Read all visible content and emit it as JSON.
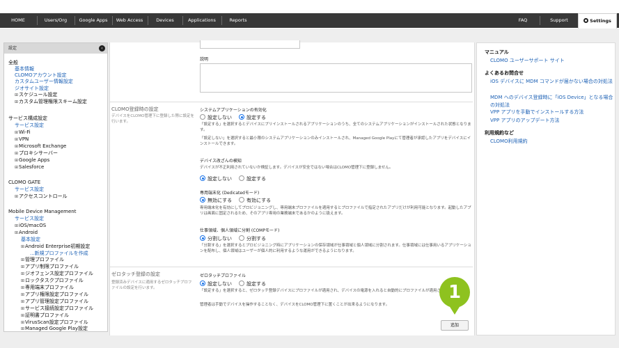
{
  "nav": {
    "items": [
      "HOME",
      "Users/Org",
      "Google Apps",
      "Web Access",
      "Devices",
      "Applications",
      "Reports"
    ],
    "right_items": [
      "FAQ",
      "Support"
    ],
    "settings_label": "Settings"
  },
  "sidebar": {
    "header": "設定",
    "collapse_icon": "‹",
    "groups": [
      {
        "title": "全般",
        "items": [
          "基本情報",
          "CLOMOアカウント設定",
          "カスタムユーザー情報設定",
          "ジオサイト設定",
          "スケジュール設定",
          "カスタム管理権限スキーム設定"
        ]
      },
      {
        "title": "サービス構成設定",
        "items": [
          "サービス設定",
          "Wi-Fi",
          "VPN",
          "Microsoft Exchange",
          "プロキシサーバー",
          "Google Apps",
          "Salesforce"
        ]
      },
      {
        "title": "CLOMO GATE",
        "items": [
          "サービス設定",
          "アクセスコントロール"
        ]
      },
      {
        "title": "Mobile Device Management",
        "items": [
          "サービス設定",
          "iOS/macOS",
          "Android",
          "基本設定",
          "Android Enterprise初期設定",
          "...新規プロファイルを作成",
          "管理プロファイル",
          "アプリ制限プロファイル",
          "ジオフェンス設定プロファイル",
          "ロックタスクプロファイル",
          "専用端末プロファイル",
          "アプリ権限設定プロファイル",
          "アプリ管理設定プロファイル",
          "サービス接続設定プロファイル",
          "証明書プロファイル",
          "VirusScan設定プロファイル",
          "Managed Google Play設定"
        ]
      }
    ]
  },
  "main": {
    "description_label": "説明",
    "section1": {
      "title": "CLOMO登録時の設定",
      "desc": "デバイスをCLOMO管理下に登録した際に設定を行います。",
      "system_apps": {
        "label": "システムアプリケーションの有効化",
        "options": [
          "設定しない",
          "設定する"
        ],
        "help1": "「設定する」を選択するとデバイスにプリインストールされるアプリケーションのうち、全てのシステムアプリケーションがインストールされた状態となります。",
        "help2": "「設定しない」を選択すると最小限のシステムアプリケーションのみインストールされ、Managed Google Playにて管理者が承認したアプリをデバイスにインストールできます。"
      },
      "tamper": {
        "label": "デバイス改ざんの検知",
        "help": "デバイスが不正利用されていないか検証します。デバイスが安全ではない場合はCLOMO管理下に登録しません。",
        "options": [
          "設定しない",
          "設定する"
        ]
      },
      "dedicated": {
        "label": "専用端末化 (Dedicatedモード)",
        "options": [
          "無効にする",
          "有効にする"
        ],
        "help1": "専用端末化を有効にしてプロビジョニングし、専用端末プロファイルを適用するとプロファイルで指定されたアプリだけが利用可能となります。起動したアプリは画面に固定されるため、そのアプリ専用の業務端末であるかのように扱えます。"
      },
      "comp": {
        "label": "仕事領域、個人領域に分割 (COMPモード)",
        "options": [
          "分割しない",
          "分割する"
        ],
        "help": "「分割する」を選択するとプロビジョニング時にアプリケーションの保存領域が仕事領域と個人領域に分割されます。仕事領域には仕事用いるアプリケーションを配布し、個人領域はユーザーが個人的に利用するような運用ができるようになります。"
      }
    },
    "section2": {
      "title": "ゼロタッチ登録の設定",
      "desc": "登録済みデバイスに適用するゼロタッチプロファイルの設定を行います。",
      "zero_touch": {
        "label": "ゼロタッチプロファイル",
        "options": [
          "設定しない",
          "設定する"
        ],
        "help1": "「設定する」を選択すると、ゼロタッチ登録デバイスにプロファイルが適用され、デバイスの電源を入れると自動的にプロファイルが適用されます。",
        "help2": "管理者は手動でデバイスを操作することなく、デバイスをCLOMO管理下に置くことが出来るようになります。"
      }
    },
    "add_button": "追加",
    "badge": "1"
  },
  "right": {
    "manual": {
      "title": "マニュアル",
      "links": [
        "CLOMO ユーザーサポート サイト"
      ]
    },
    "faq": {
      "title": "よくあるお問合せ",
      "links": [
        "iOS デバイスに MDM コマンドが届かない場合の対処法",
        "MDM へのデバイス登録時に「iOS Device」となる場合の対処法",
        "VPP アプリを手動でインストールする方法",
        "VPP アプリのアップデート方法"
      ]
    },
    "terms": {
      "title": "利用規約など",
      "links": [
        "CLOMO利用規約"
      ]
    }
  },
  "colors": {
    "nav_bg": "#383838",
    "link": "#1a5fb4",
    "badge": "#8ec21f",
    "radio_on": "#1a73e8"
  }
}
